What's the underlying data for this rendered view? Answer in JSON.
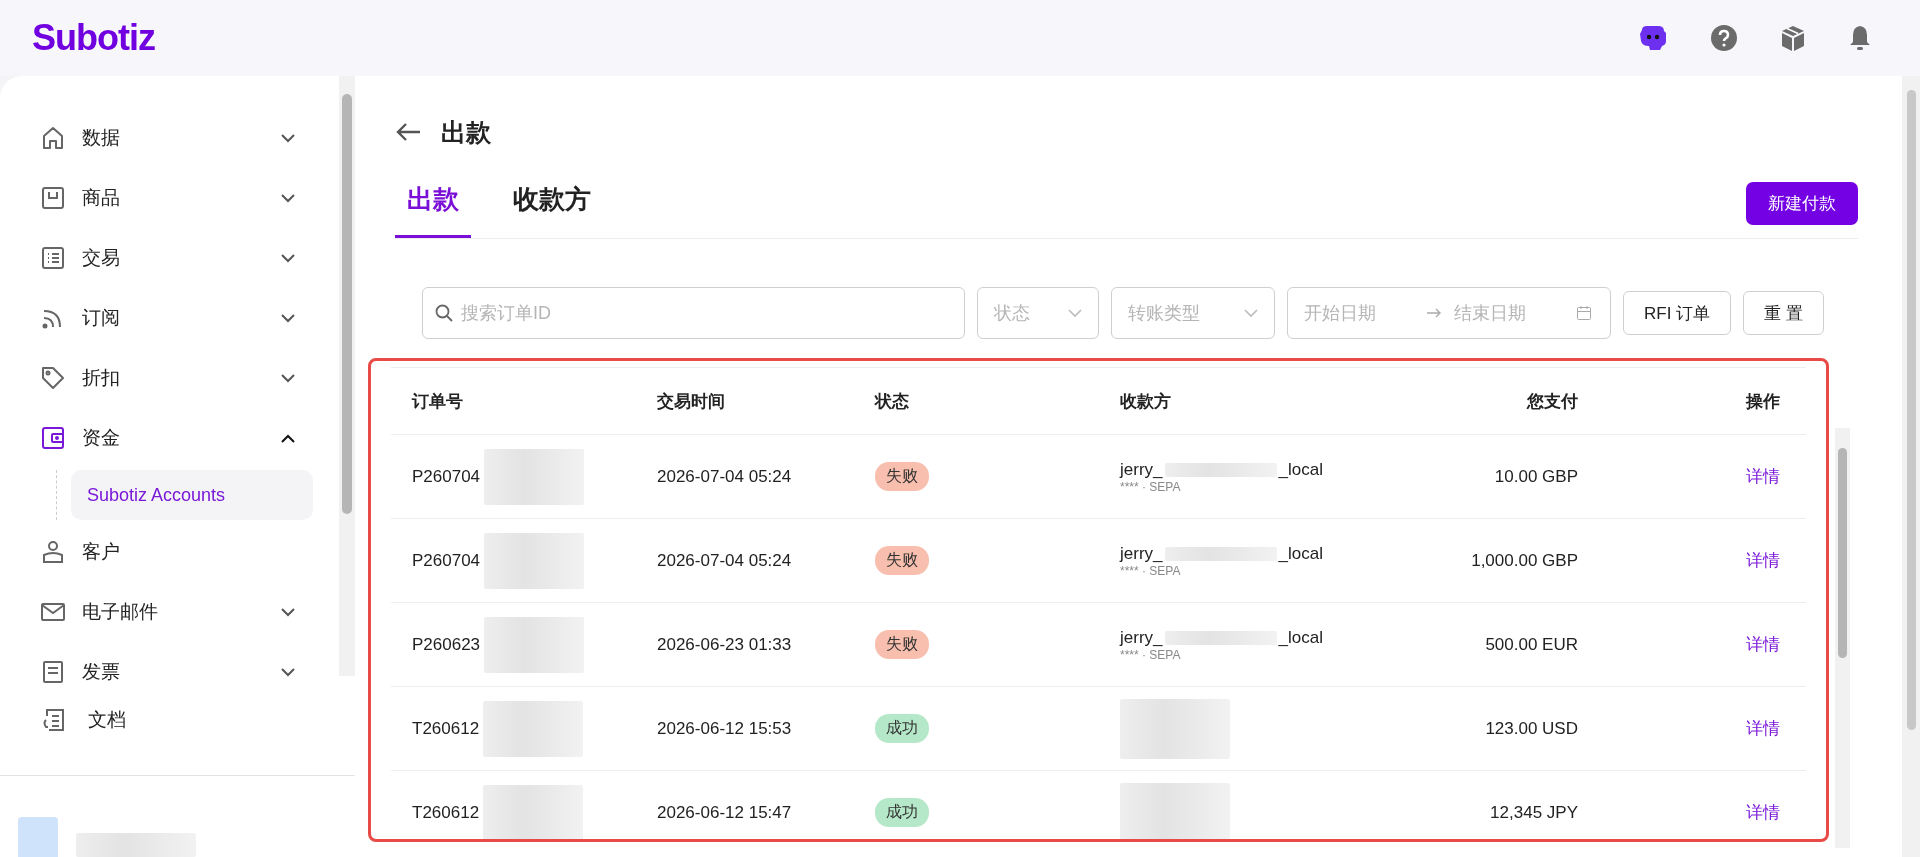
{
  "header": {
    "logo": "Subotiz"
  },
  "sidebar": {
    "items": [
      {
        "label": "数据",
        "kind": "group",
        "expanded": false,
        "selected": false
      },
      {
        "label": "商品",
        "kind": "group",
        "expanded": false,
        "selected": false
      },
      {
        "label": "交易",
        "kind": "group",
        "expanded": false,
        "selected": false
      },
      {
        "label": "订阅",
        "kind": "group",
        "expanded": false,
        "selected": false
      },
      {
        "label": "折扣",
        "kind": "group",
        "expanded": false,
        "selected": false
      },
      {
        "label": "资金",
        "kind": "group",
        "expanded": true,
        "selected": true,
        "children": [
          {
            "label": "Subotiz Accounts",
            "selected": true
          }
        ]
      },
      {
        "label": "客户",
        "kind": "link",
        "selected": false
      },
      {
        "label": "电子邮件",
        "kind": "group",
        "expanded": false,
        "selected": false
      },
      {
        "label": "发票",
        "kind": "group",
        "expanded": false,
        "selected": false
      }
    ],
    "footer_item": {
      "label": "文档"
    }
  },
  "page": {
    "title": "出款",
    "tabs": [
      {
        "label": "出款",
        "selected": true
      },
      {
        "label": "收款方",
        "selected": false
      }
    ],
    "new_button": "新建付款",
    "filters": {
      "search": {
        "placeholder": "搜索订单ID"
      },
      "status": {
        "placeholder": "状态"
      },
      "type": {
        "placeholder": "转账类型"
      },
      "start_date": {
        "placeholder": "开始日期"
      },
      "end_date": {
        "placeholder": "结束日期"
      },
      "rfi_button": "RFI 订单",
      "reset_button": "重 置"
    }
  },
  "table": {
    "columns": [
      "订单号",
      "交易时间",
      "状态",
      "收款方",
      "您支付",
      "操作"
    ],
    "rows": [
      {
        "order_id": "P260704",
        "time": "2026-07-04 05:24",
        "status": {
          "label": "失败",
          "color": "#f9bfae"
        },
        "payee": {
          "prefix": "jerry_",
          "suffix": "_local",
          "detail": "**** · SEPA"
        },
        "amount": "10.00 GBP",
        "action": "详情"
      },
      {
        "order_id": "P260704",
        "time": "2026-07-04 05:24",
        "status": {
          "label": "失败",
          "color": "#f9bfae"
        },
        "payee": {
          "prefix": "jerry_",
          "suffix": "_local",
          "detail": "**** · SEPA"
        },
        "amount": "1,000.00 GBP",
        "action": "详情"
      },
      {
        "order_id": "P260623",
        "time": "2026-06-23 01:33",
        "status": {
          "label": "失败",
          "color": "#f9bfae"
        },
        "payee": {
          "prefix": "jerry_",
          "suffix": "_local",
          "detail": "**** · SEPA"
        },
        "amount": "500.00 EUR",
        "action": "详情"
      },
      {
        "order_id": "T260612",
        "time": "2026-06-12 15:53",
        "status": {
          "label": "成功",
          "color": "#b5e8c8"
        },
        "amount": "123.00 USD",
        "action": "详情"
      },
      {
        "order_id": "T260612",
        "time": "2026-06-12 15:47",
        "status": {
          "label": "成功",
          "color": "#b5e8c8"
        },
        "amount": "12,345 JPY",
        "action": "详情"
      }
    ]
  }
}
